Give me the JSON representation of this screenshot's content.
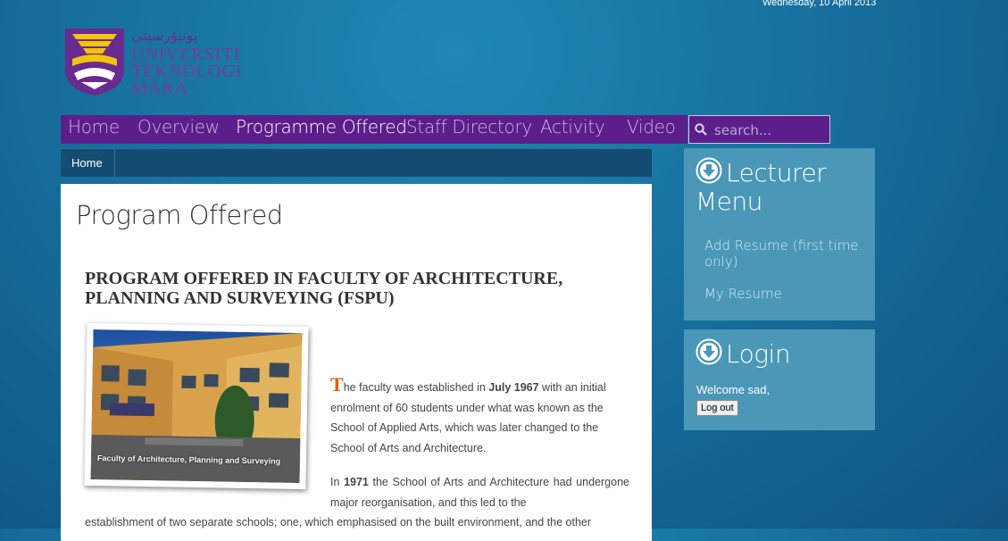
{
  "header": {
    "date": "Wednesday, 10 April 2013",
    "logo": {
      "jawi": "ﻳﻮﻧﻴﯘﺭﺳﻴﺘﻲ",
      "line1": "UNIVERSITI",
      "line2": "TEKNOLOGI",
      "line3": "MARA"
    }
  },
  "nav": {
    "items": [
      "Home",
      "Overview",
      "Programme Offered",
      "Staff Directory",
      "Activity",
      "Video"
    ],
    "active": "Programme Offered",
    "search_placeholder": "search..."
  },
  "breadcrumb": {
    "home": "Home"
  },
  "main": {
    "page_title": "Program Offered",
    "article_title": "PROGRAM OFFERED IN FACULTY OF ARCHITECTURE, PLANNING AND SURVEYING (FSPU)",
    "photo_caption": "Faculty of Architecture, Planning and Surveying",
    "p1_dropcap": "T",
    "p1_a": "he faculty was established in ",
    "p1_b": "July 1967",
    "p1_c": " with an initial enrolment of 60 students under what was known as the School of Applied Arts, which was later changed to the School of Arts and Architecture.",
    "p2_a": "In ",
    "p2_b": "1971",
    "p2_c": " the School of Arts and Architecture had undergone major reorganisation, and this led to the",
    "p3": "establishment of two separate schools; one, which emphasised on the built environment, and the other"
  },
  "sidebar": {
    "lecturer_menu": {
      "title_line1": "Lecturer",
      "title_line2": "Menu",
      "links": [
        "Add Resume (first time only)",
        "My Resume"
      ]
    },
    "login": {
      "title": "Login",
      "welcome": "Welcome sad,",
      "logout_label": "Log out"
    }
  },
  "colors": {
    "nav_purple": "#5b1e8a",
    "sidebar_box": "#4a97b8",
    "dropcap_orange": "#e06010"
  }
}
